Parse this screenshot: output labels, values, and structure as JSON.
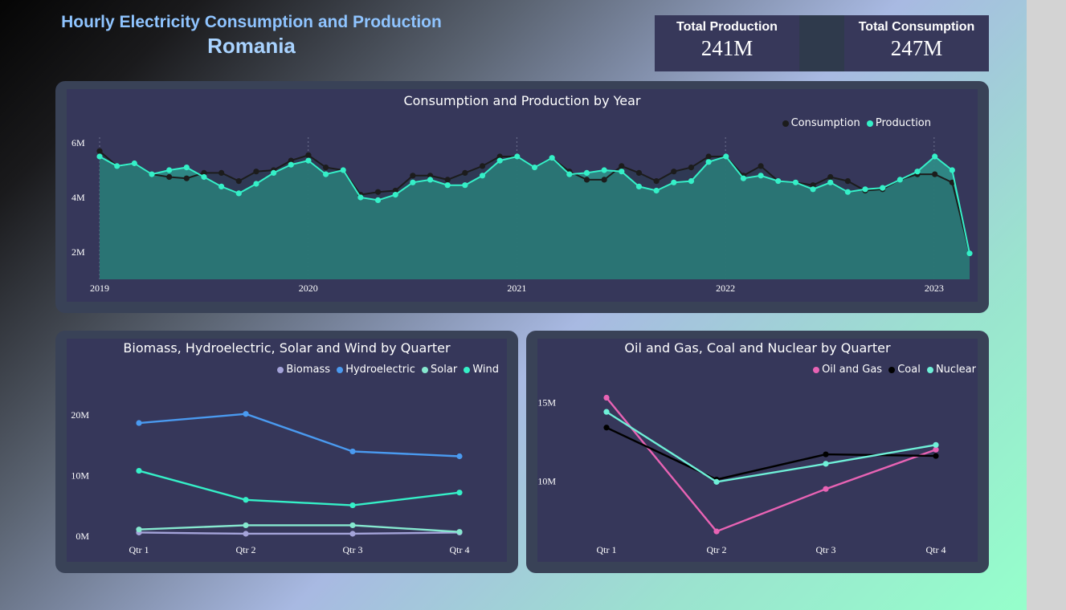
{
  "header": {
    "title_line1": "Hourly Electricity Consumption and Production",
    "title_line2": "Romania"
  },
  "kpis": [
    {
      "label": "Total Production",
      "value": "241M"
    },
    {
      "label": "Total Consumption",
      "value": "247M"
    }
  ],
  "colors": {
    "consumption": "#1c1c1c",
    "production": "#35f0c8",
    "area_fill": "#2f8a87",
    "biomass": "#a4a3d9",
    "hydroelectric": "#4a9af0",
    "solar": "#86e8cf",
    "wind": "#35f0c8",
    "oil_gas": "#e863b4",
    "coal": "#000000",
    "nuclear": "#6ff0d8"
  },
  "chart_data": [
    {
      "type": "area",
      "title": "Consumption and Production by Year",
      "legend": [
        "Consumption",
        "Production"
      ],
      "legend_position": "top-right",
      "x_ticks": [
        "2019",
        "2020",
        "2021",
        "2022",
        "2023"
      ],
      "y_ticks": [
        {
          "value": 2,
          "label": "2M"
        },
        {
          "value": 4,
          "label": "4M"
        },
        {
          "value": 6,
          "label": "6M"
        }
      ],
      "x_range": [
        2019,
        2023.17
      ],
      "ylim": [
        1,
        6.5
      ],
      "grid": false,
      "series": [
        {
          "name": "Consumption",
          "values": [
            5.7,
            5.15,
            5.25,
            4.85,
            4.75,
            4.7,
            4.9,
            4.9,
            4.6,
            4.95,
            5.0,
            5.35,
            5.55,
            5.1,
            5.0,
            4.1,
            4.2,
            4.25,
            4.8,
            4.8,
            4.65,
            4.9,
            5.15,
            5.5,
            5.5,
            5.1,
            5.45,
            4.95,
            4.65,
            4.65,
            5.15,
            4.9,
            4.6,
            4.95,
            5.1,
            5.5,
            5.5,
            4.8,
            5.15,
            4.6,
            4.55,
            4.45,
            4.75,
            4.6,
            4.25,
            4.3,
            4.65,
            4.85,
            4.85,
            4.55,
            1.95
          ]
        },
        {
          "name": "Production",
          "values": [
            5.5,
            5.15,
            5.25,
            4.85,
            5.0,
            5.1,
            4.75,
            4.4,
            4.15,
            4.5,
            4.9,
            5.2,
            5.35,
            4.85,
            5.0,
            4.0,
            3.9,
            4.1,
            4.55,
            4.65,
            4.45,
            4.45,
            4.8,
            5.35,
            5.5,
            5.1,
            5.45,
            4.85,
            4.9,
            5.0,
            4.95,
            4.4,
            4.25,
            4.55,
            4.6,
            5.3,
            5.5,
            4.7,
            4.8,
            4.6,
            4.55,
            4.3,
            4.55,
            4.2,
            4.3,
            4.35,
            4.65,
            4.95,
            5.5,
            5.0,
            1.95
          ]
        }
      ]
    },
    {
      "type": "line",
      "title": "Biomass, Hydroelectric, Solar and Wind by Quarter",
      "categories": [
        "Qtr 1",
        "Qtr 2",
        "Qtr 3",
        "Qtr 4"
      ],
      "legend": [
        "Biomass",
        "Hydroelectric",
        "Solar",
        "Wind"
      ],
      "legend_position": "top-right",
      "y_ticks": [
        {
          "value": 0,
          "label": "0M"
        },
        {
          "value": 10,
          "label": "10M"
        },
        {
          "value": 20,
          "label": "20M"
        }
      ],
      "ylim": [
        0,
        26
      ],
      "series": [
        {
          "name": "Biomass",
          "values": [
            0.6,
            0.4,
            0.4,
            0.6
          ]
        },
        {
          "name": "Hydroelectric",
          "values": [
            18.7,
            20.2,
            14.0,
            13.2
          ]
        },
        {
          "name": "Solar",
          "values": [
            1.1,
            1.8,
            1.8,
            0.7
          ]
        },
        {
          "name": "Wind",
          "values": [
            10.8,
            6.0,
            5.1,
            7.2
          ]
        }
      ]
    },
    {
      "type": "line",
      "title": "Oil and Gas, Coal and Nuclear by Quarter",
      "categories": [
        "Qtr 1",
        "Qtr 2",
        "Qtr 3",
        "Qtr 4"
      ],
      "legend": [
        "Oil and Gas",
        "Coal",
        "Nuclear"
      ],
      "legend_position": "top-right",
      "y_ticks": [
        {
          "value": 10,
          "label": "10M"
        },
        {
          "value": 15,
          "label": "15M"
        }
      ],
      "ylim": [
        6.5,
        16.5
      ],
      "series": [
        {
          "name": "Oil and Gas",
          "values": [
            15.3,
            6.8,
            9.5,
            12.0
          ]
        },
        {
          "name": "Coal",
          "values": [
            13.4,
            10.1,
            11.7,
            11.6
          ]
        },
        {
          "name": "Nuclear",
          "values": [
            14.4,
            9.95,
            11.1,
            12.3
          ]
        }
      ]
    }
  ]
}
